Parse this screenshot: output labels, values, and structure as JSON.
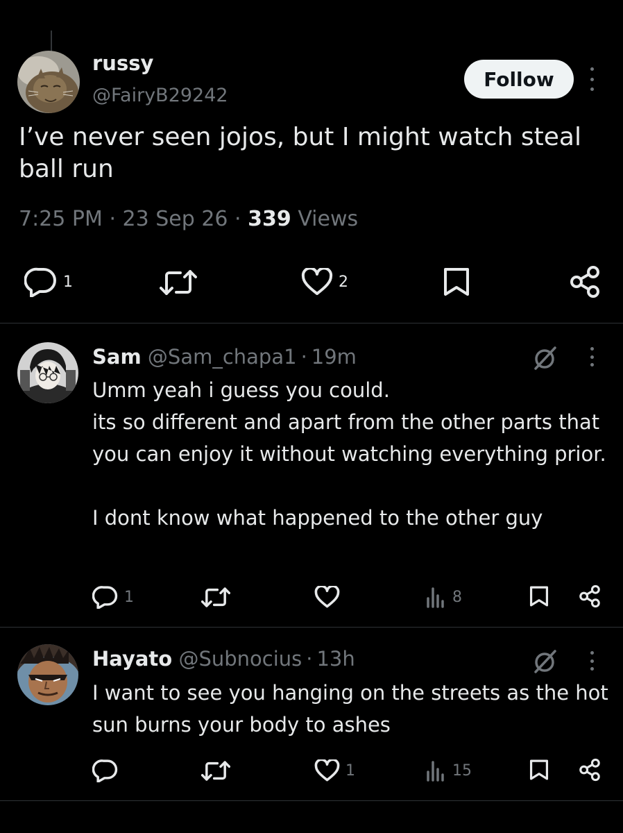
{
  "main_tweet": {
    "name": "russy",
    "handle": "@FairyB29242",
    "follow_label": "Follow",
    "text": "I’ve never seen jojos, but I might watch steal ball run",
    "time": "7:25 PM",
    "sep1": "·",
    "date": "23 Sep 26",
    "sep2": "·",
    "views_count": "339",
    "views_label": "Views",
    "actions": {
      "replies": "1",
      "retweets": "",
      "likes": "2"
    },
    "icons": [
      "reply-icon",
      "retweet-icon",
      "like-icon",
      "bookmark-icon",
      "share-icon"
    ]
  },
  "replies": [
    {
      "name": "Sam",
      "handle": "@Sam_chapa1",
      "sep": "·",
      "time": "19m",
      "text": "Umm yeah i guess you could.\nits so different and apart from the other parts that you can enjoy it without watching everything prior.\n\nI dont know what happened to the other guy",
      "replies": "1",
      "retweets": "",
      "likes": "",
      "views": "8"
    },
    {
      "name": "Hayato",
      "handle": "@Subnocius",
      "sep": "·",
      "time": "13h",
      "text": "I want to see you hanging on the streets as the hot sun burns your body to ashes",
      "replies": "",
      "retweets": "",
      "likes": "1",
      "views": "15"
    }
  ],
  "colors": {
    "background": "#000000",
    "text": "#e7e9ea",
    "secondary": "#71767b",
    "divider": "#2f3336",
    "follow_bg": "#eff3f4"
  }
}
